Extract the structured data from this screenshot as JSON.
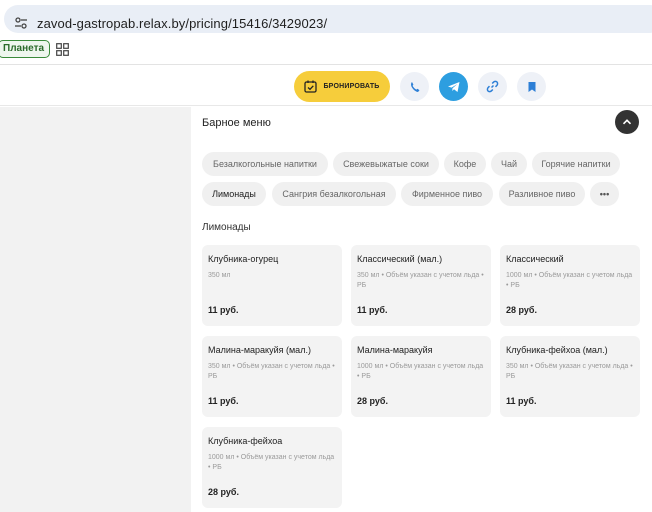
{
  "browser": {
    "url": "zavod-gastropab.relax.by/pricing/15416/3429023/",
    "bookmark_label": "Планета"
  },
  "toolbar": {
    "book_label": "БРОНИРОВАТЬ",
    "icons": [
      "calendar-check-icon",
      "phone-icon",
      "telegram-icon",
      "link-icon",
      "bookmark-icon"
    ]
  },
  "menu": {
    "section_title": "Барное меню",
    "chips": [
      {
        "label": "Безалкогольные напитки",
        "active": false
      },
      {
        "label": "Свежевыжатые соки",
        "active": false
      },
      {
        "label": "Кофе",
        "active": false
      },
      {
        "label": "Чай",
        "active": false
      },
      {
        "label": "Горячие напитки",
        "active": false
      },
      {
        "label": "Лимонады",
        "active": true
      },
      {
        "label": "Сангрия безалкогольная",
        "active": false
      },
      {
        "label": "Фирменное пиво",
        "active": false
      },
      {
        "label": "Разливное пиво",
        "active": false
      },
      {
        "label": "•••",
        "active": false
      }
    ],
    "category_title": "Лимонады",
    "items": [
      {
        "name": "Клубника-огурец",
        "desc": "350 мл",
        "price": "11 руб."
      },
      {
        "name": "Классический (мал.)",
        "desc": "350 мл • Объём указан с учетом льда • РБ",
        "price": "11 руб."
      },
      {
        "name": "Классический",
        "desc": "1000 мл • Объём указан с учетом льда • РБ",
        "price": "28 руб."
      },
      {
        "name": "Малина-маракуйя (мал.)",
        "desc": "350 мл • Объём указан с учетом льда • РБ",
        "price": "11 руб."
      },
      {
        "name": "Малина-маракуйя",
        "desc": "1000 мл • Объём указан с учетом льда • РБ",
        "price": "28 руб."
      },
      {
        "name": "Клубника-фейхоа (мал.)",
        "desc": "350 мл • Объём указан с учетом льда • РБ",
        "price": "11 руб."
      },
      {
        "name": "Клубника-фейхоа",
        "desc": "1000 мл • Объём указан с учетом льда • РБ",
        "price": "28 руб."
      }
    ]
  },
  "colors": {
    "accent_yellow": "#f6cd3b",
    "telegram_blue": "#2d9ee0",
    "card_bg": "#f3f3f3",
    "chip_bg": "#f0f0f0"
  }
}
